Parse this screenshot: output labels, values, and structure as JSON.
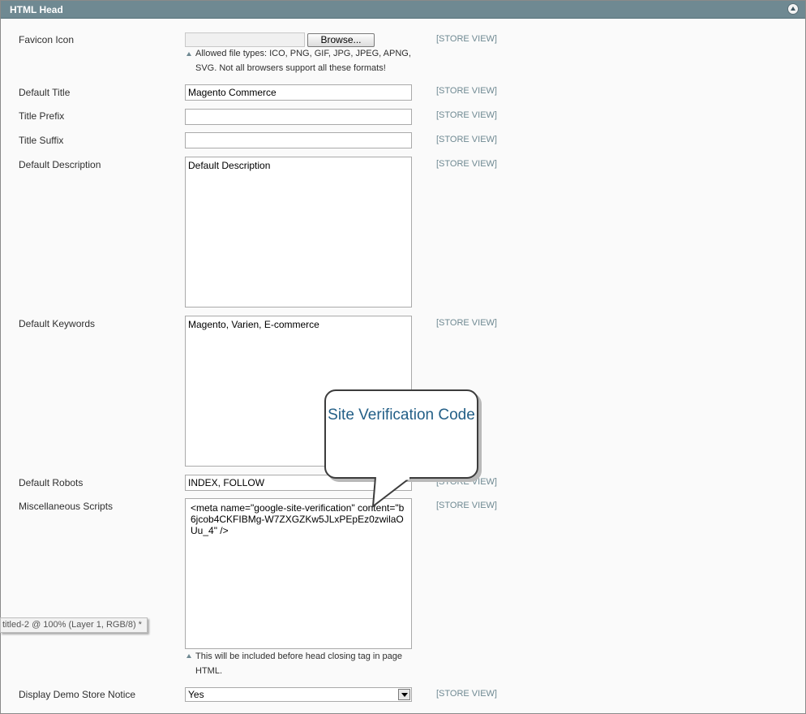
{
  "panel": {
    "title": "HTML Head"
  },
  "fields": {
    "favicon": {
      "label": "Favicon Icon",
      "button": "Browse...",
      "note": "Allowed file types: ICO, PNG, GIF, JPG, JPEG, APNG, SVG. Not all browsers support all these formats!",
      "scope": "[STORE VIEW]"
    },
    "default_title": {
      "label": "Default Title",
      "value": "Magento Commerce",
      "scope": "[STORE VIEW]"
    },
    "title_prefix": {
      "label": "Title Prefix",
      "value": "",
      "scope": "[STORE VIEW]"
    },
    "title_suffix": {
      "label": "Title Suffix",
      "value": "",
      "scope": "[STORE VIEW]"
    },
    "default_description": {
      "label": "Default Description",
      "value": "Default Description",
      "scope": "[STORE VIEW]"
    },
    "default_keywords": {
      "label": "Default Keywords",
      "value": "Magento, Varien, E-commerce",
      "scope": "[STORE VIEW]"
    },
    "default_robots": {
      "label": "Default Robots",
      "value": "INDEX, FOLLOW",
      "scope": "[STORE VIEW]"
    },
    "misc_scripts": {
      "label": "Miscellaneous Scripts",
      "value": "<meta name=\"google-site-verification\" content=\"b6jcob4CKFIBMg-W7ZXGZKw5JLxPEpEz0zwilaOUu_4\" />",
      "note": "This will be included before head closing tag in page HTML.",
      "scope": "[STORE VIEW]"
    },
    "demo_notice": {
      "label": "Display Demo Store Notice",
      "value": "Yes",
      "scope": "[STORE VIEW]"
    }
  },
  "callout": {
    "text": "Site Verification Code"
  },
  "overlay": {
    "text": "titled-2 @ 100% (Layer 1, RGB/8) *"
  },
  "colors": {
    "header": "#6f8992",
    "scope": "#6f8992",
    "callout_text": "#235f87"
  }
}
